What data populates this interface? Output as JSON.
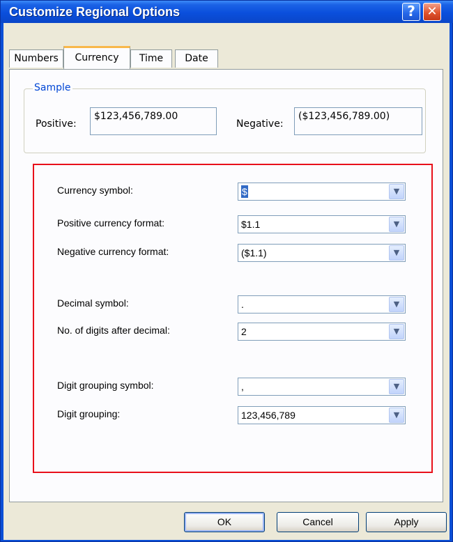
{
  "window": {
    "title": "Customize Regional Options",
    "help_glyph": "?",
    "close_glyph": "✕"
  },
  "tabs": [
    {
      "label": "Numbers",
      "active": false
    },
    {
      "label": "Currency",
      "active": true
    },
    {
      "label": "Time",
      "active": false
    },
    {
      "label": "Date",
      "active": false
    }
  ],
  "sample": {
    "legend": "Sample",
    "positive_label": "Positive:",
    "positive_value": "$123,456,789.00",
    "negative_label": "Negative:",
    "negative_value": "($123,456,789.00)"
  },
  "fields": {
    "currency_symbol": {
      "label": "Currency symbol:",
      "value": "$"
    },
    "positive_format": {
      "label": "Positive currency format:",
      "value": "$1.1"
    },
    "negative_format": {
      "label": "Negative currency format:",
      "value": "($1.1)"
    },
    "decimal_symbol": {
      "label": "Decimal symbol:",
      "value": "."
    },
    "digits_after_decimal": {
      "label": "No. of digits after decimal:",
      "value": "2"
    },
    "grouping_symbol": {
      "label": "Digit grouping symbol:",
      "value": ","
    },
    "digit_grouping": {
      "label": "Digit grouping:",
      "value": "123,456,789"
    }
  },
  "buttons": {
    "ok": "OK",
    "cancel": "Cancel",
    "apply": "Apply"
  },
  "colors": {
    "titlebar": "#0a4fdc",
    "highlight_box": "#e8101a",
    "active_tab_accent": "#f8b84a",
    "group_legend": "#0046d5"
  }
}
